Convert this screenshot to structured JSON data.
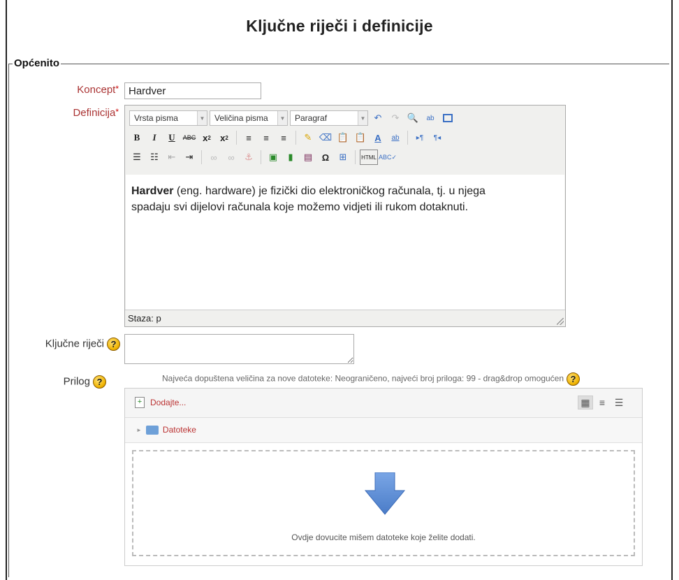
{
  "page": {
    "title": "Ključne riječi i definicije"
  },
  "section": {
    "legend": "Općenito"
  },
  "concept": {
    "label": "Koncept",
    "value": "Hardver"
  },
  "definition": {
    "label": "Definicija",
    "toolbar": {
      "font_family": "Vrsta pisma",
      "font_size": "Veličina pisma",
      "format": "Paragraf"
    },
    "content_bold": "Hardver",
    "content_line1": " (eng. hardware) je fizički dio elektroničkog računala, tj. u njega",
    "content_line2": "spadaju svi dijelovi računala koje možemo vidjeti ili rukom dotaknuti.",
    "path": "Staza: p"
  },
  "keywords": {
    "label": "Ključne riječi",
    "value": ""
  },
  "attachment": {
    "label": "Prilog",
    "note": "Najveća dopuštena veličina za nove datoteke: Neograničeno, najveći broj priloga: 99 - drag&drop omogućen",
    "add_label": "Dodajte...",
    "folder_label": "Datoteke",
    "drop_text": "Ovdje dovucite mišem datoteke koje želite dodati."
  },
  "colors": {
    "label_required": "#aa3333",
    "drop_arrow": "#5b8bd6",
    "folder": "#6ea0d8"
  },
  "icons": [
    "help-icon",
    "undo-icon",
    "redo-icon",
    "find-icon",
    "replace-icon",
    "fullscreen-icon",
    "add-file-icon",
    "folder-icon",
    "download-arrow-icon"
  ]
}
